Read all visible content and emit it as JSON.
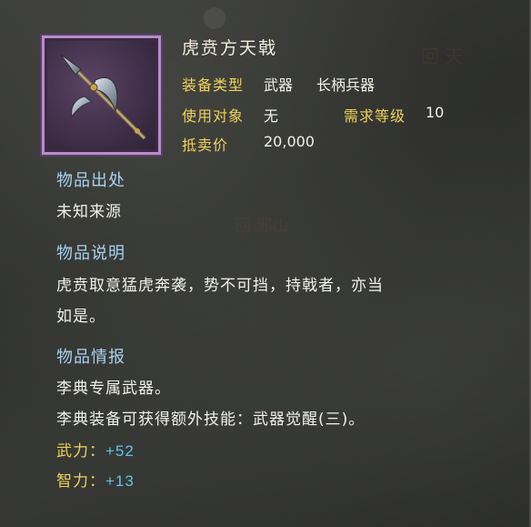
{
  "item": {
    "name": "虎贲方天戟",
    "icon": "halberd-icon",
    "frame_color": "#b58fc4",
    "details": {
      "type_label": "装备类型",
      "type_value1": "武器",
      "type_value2": "长柄兵器",
      "target_label": "使用对象",
      "target_value": "无",
      "level_label": "需求等级",
      "level_value": "10",
      "sell_label": "抵卖价",
      "sell_value": "20,000"
    }
  },
  "source": {
    "title": "物品出处",
    "text": "未知来源"
  },
  "description": {
    "title": "物品说明",
    "line1": "虎贲取意猛虎奔袭，势不可挡，持戟者，亦当",
    "line2": "如是。"
  },
  "info": {
    "title": "物品情报",
    "line1": "李典专属武器。",
    "line2": "李典装备可获得额外技能：武器觉醒(三)。",
    "stats": [
      {
        "label": "武力：",
        "value": "+52"
      },
      {
        "label": "智力：",
        "value": "+13"
      }
    ]
  },
  "watermarks": {
    "top": "回 天",
    "mid": "回 邪山"
  },
  "colors": {
    "label": "#f0d25a",
    "section": "#a8d2f2",
    "stat_value": "#5cc6ee",
    "text": "#f2f0ea"
  }
}
